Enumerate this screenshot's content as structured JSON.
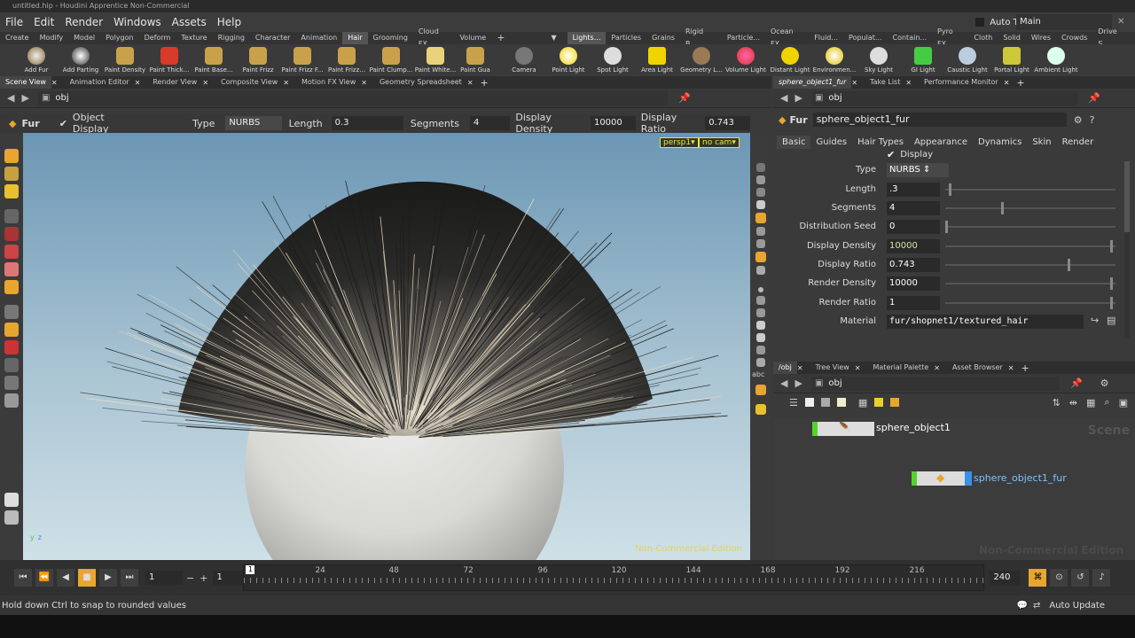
{
  "window": {
    "title": "untitled.hip - Houdini Apprentice Non-Commercial"
  },
  "menu": [
    "File",
    "Edit",
    "Render",
    "Windows",
    "Assets",
    "Help"
  ],
  "takes": {
    "auto_takes_label": "Auto Takes",
    "desktop": "Main"
  },
  "shelf_tabs_left": [
    "Create",
    "Modify",
    "Model",
    "Polygon",
    "Deform",
    "Texture",
    "Rigging",
    "Character",
    "Animation",
    "Hair",
    "Grooming",
    "Cloud FX",
    "Volume"
  ],
  "shelf_tabs_right": [
    "Lights...",
    "Particles",
    "Grains",
    "Rigid B...",
    "Particle...",
    "Ocean FX",
    "Fluid...",
    "Populat...",
    "Contain...",
    "Pyro FX",
    "Cloth",
    "Solid",
    "Wires",
    "Crowds",
    "Drive S..."
  ],
  "shelf_tools_left": [
    "Add Fur",
    "Add Parting",
    "Paint Density",
    "Paint Thick...",
    "Paint Base...",
    "Paint Frizz",
    "Paint Frizz F...",
    "Paint Frizz...",
    "Paint Clump...",
    "Paint White...",
    "Paint Gua"
  ],
  "shelf_tools_right": [
    "Camera",
    "Point Light",
    "Spot Light",
    "Area Light",
    "Geometry L...",
    "Volume Light",
    "Distant Light",
    "Environmen...",
    "Sky Light",
    "GI Light",
    "Caustic Light",
    "Portal Light",
    "Ambient Light"
  ],
  "left_pane_tabs": [
    "Scene View",
    "Animation Editor",
    "Render View",
    "Composite View",
    "Motion FX View",
    "Geometry Spreadsheet"
  ],
  "left_path": "obj",
  "opbar": {
    "node_label": "Fur",
    "object_display": "Object Display",
    "type_label": "Type",
    "type_value": "NURBS",
    "length_label": "Length",
    "length_value": "0.3",
    "segments_label": "Segments",
    "segments_value": "4",
    "display_density_label": "Display Density",
    "display_density_value": "10000",
    "display_ratio_label": "Display Ratio",
    "display_ratio_value": "0.743"
  },
  "viewport": {
    "camera": "persp1",
    "cam_menu": "no cam",
    "watermark": "Non-Commercial Edition"
  },
  "right_top_tabs": [
    "sphere_object1_fur",
    "Take List",
    "Performance Monitor"
  ],
  "right_path": "obj",
  "params": {
    "node_type": "Fur",
    "node_name": "sphere_object1_fur",
    "tabs": [
      "Basic",
      "Guides",
      "Hair Types",
      "Appearance",
      "Dynamics",
      "Skin",
      "Render"
    ],
    "display_label": "Display",
    "rows": [
      {
        "label": "Type",
        "value": "NURBS",
        "slider": null
      },
      {
        "label": "Length",
        "value": ".3",
        "slider": 0.02
      },
      {
        "label": "Segments",
        "value": "4",
        "slider": 0.34
      },
      {
        "label": "Distribution Seed",
        "value": "0",
        "slider": 0.0
      },
      {
        "label": "Display Density",
        "value": "10000",
        "slider": 1.0
      },
      {
        "label": "Display Ratio",
        "value": "0.743",
        "slider": 0.743
      },
      {
        "label": "Render Density",
        "value": "10000",
        "slider": 1.0
      },
      {
        "label": "Render Ratio",
        "value": "1",
        "slider": 1.0
      },
      {
        "label": "Material",
        "value": "fur/shopnet1/textured_hair",
        "slider": null
      }
    ]
  },
  "network_tabs": [
    "/obj",
    "Tree View",
    "Material Palette",
    "Asset Browser"
  ],
  "network_path": "obj",
  "network": {
    "nodes": [
      {
        "name": "sphere_object1"
      },
      {
        "name": "sphere_object1_fur"
      }
    ],
    "context_watermark": "Scene",
    "watermark": "Non-Commercial Edition"
  },
  "timeline": {
    "current_frame": "1",
    "start_frame": "1",
    "end_frame": "240",
    "ticks": [
      "1",
      "24",
      "48",
      "72",
      "96",
      "120",
      "144",
      "168",
      "192",
      "216"
    ]
  },
  "status": {
    "message": "Hold down Ctrl to snap to rounded values",
    "update_mode": "Auto Update"
  },
  "colors": {
    "accent": "#e8a530",
    "node_selected": "#3b8fe8",
    "node_display_flag": "#53d42a",
    "viewport_top": "#6b96b4",
    "viewport_bottom": "#cfe0e7"
  }
}
